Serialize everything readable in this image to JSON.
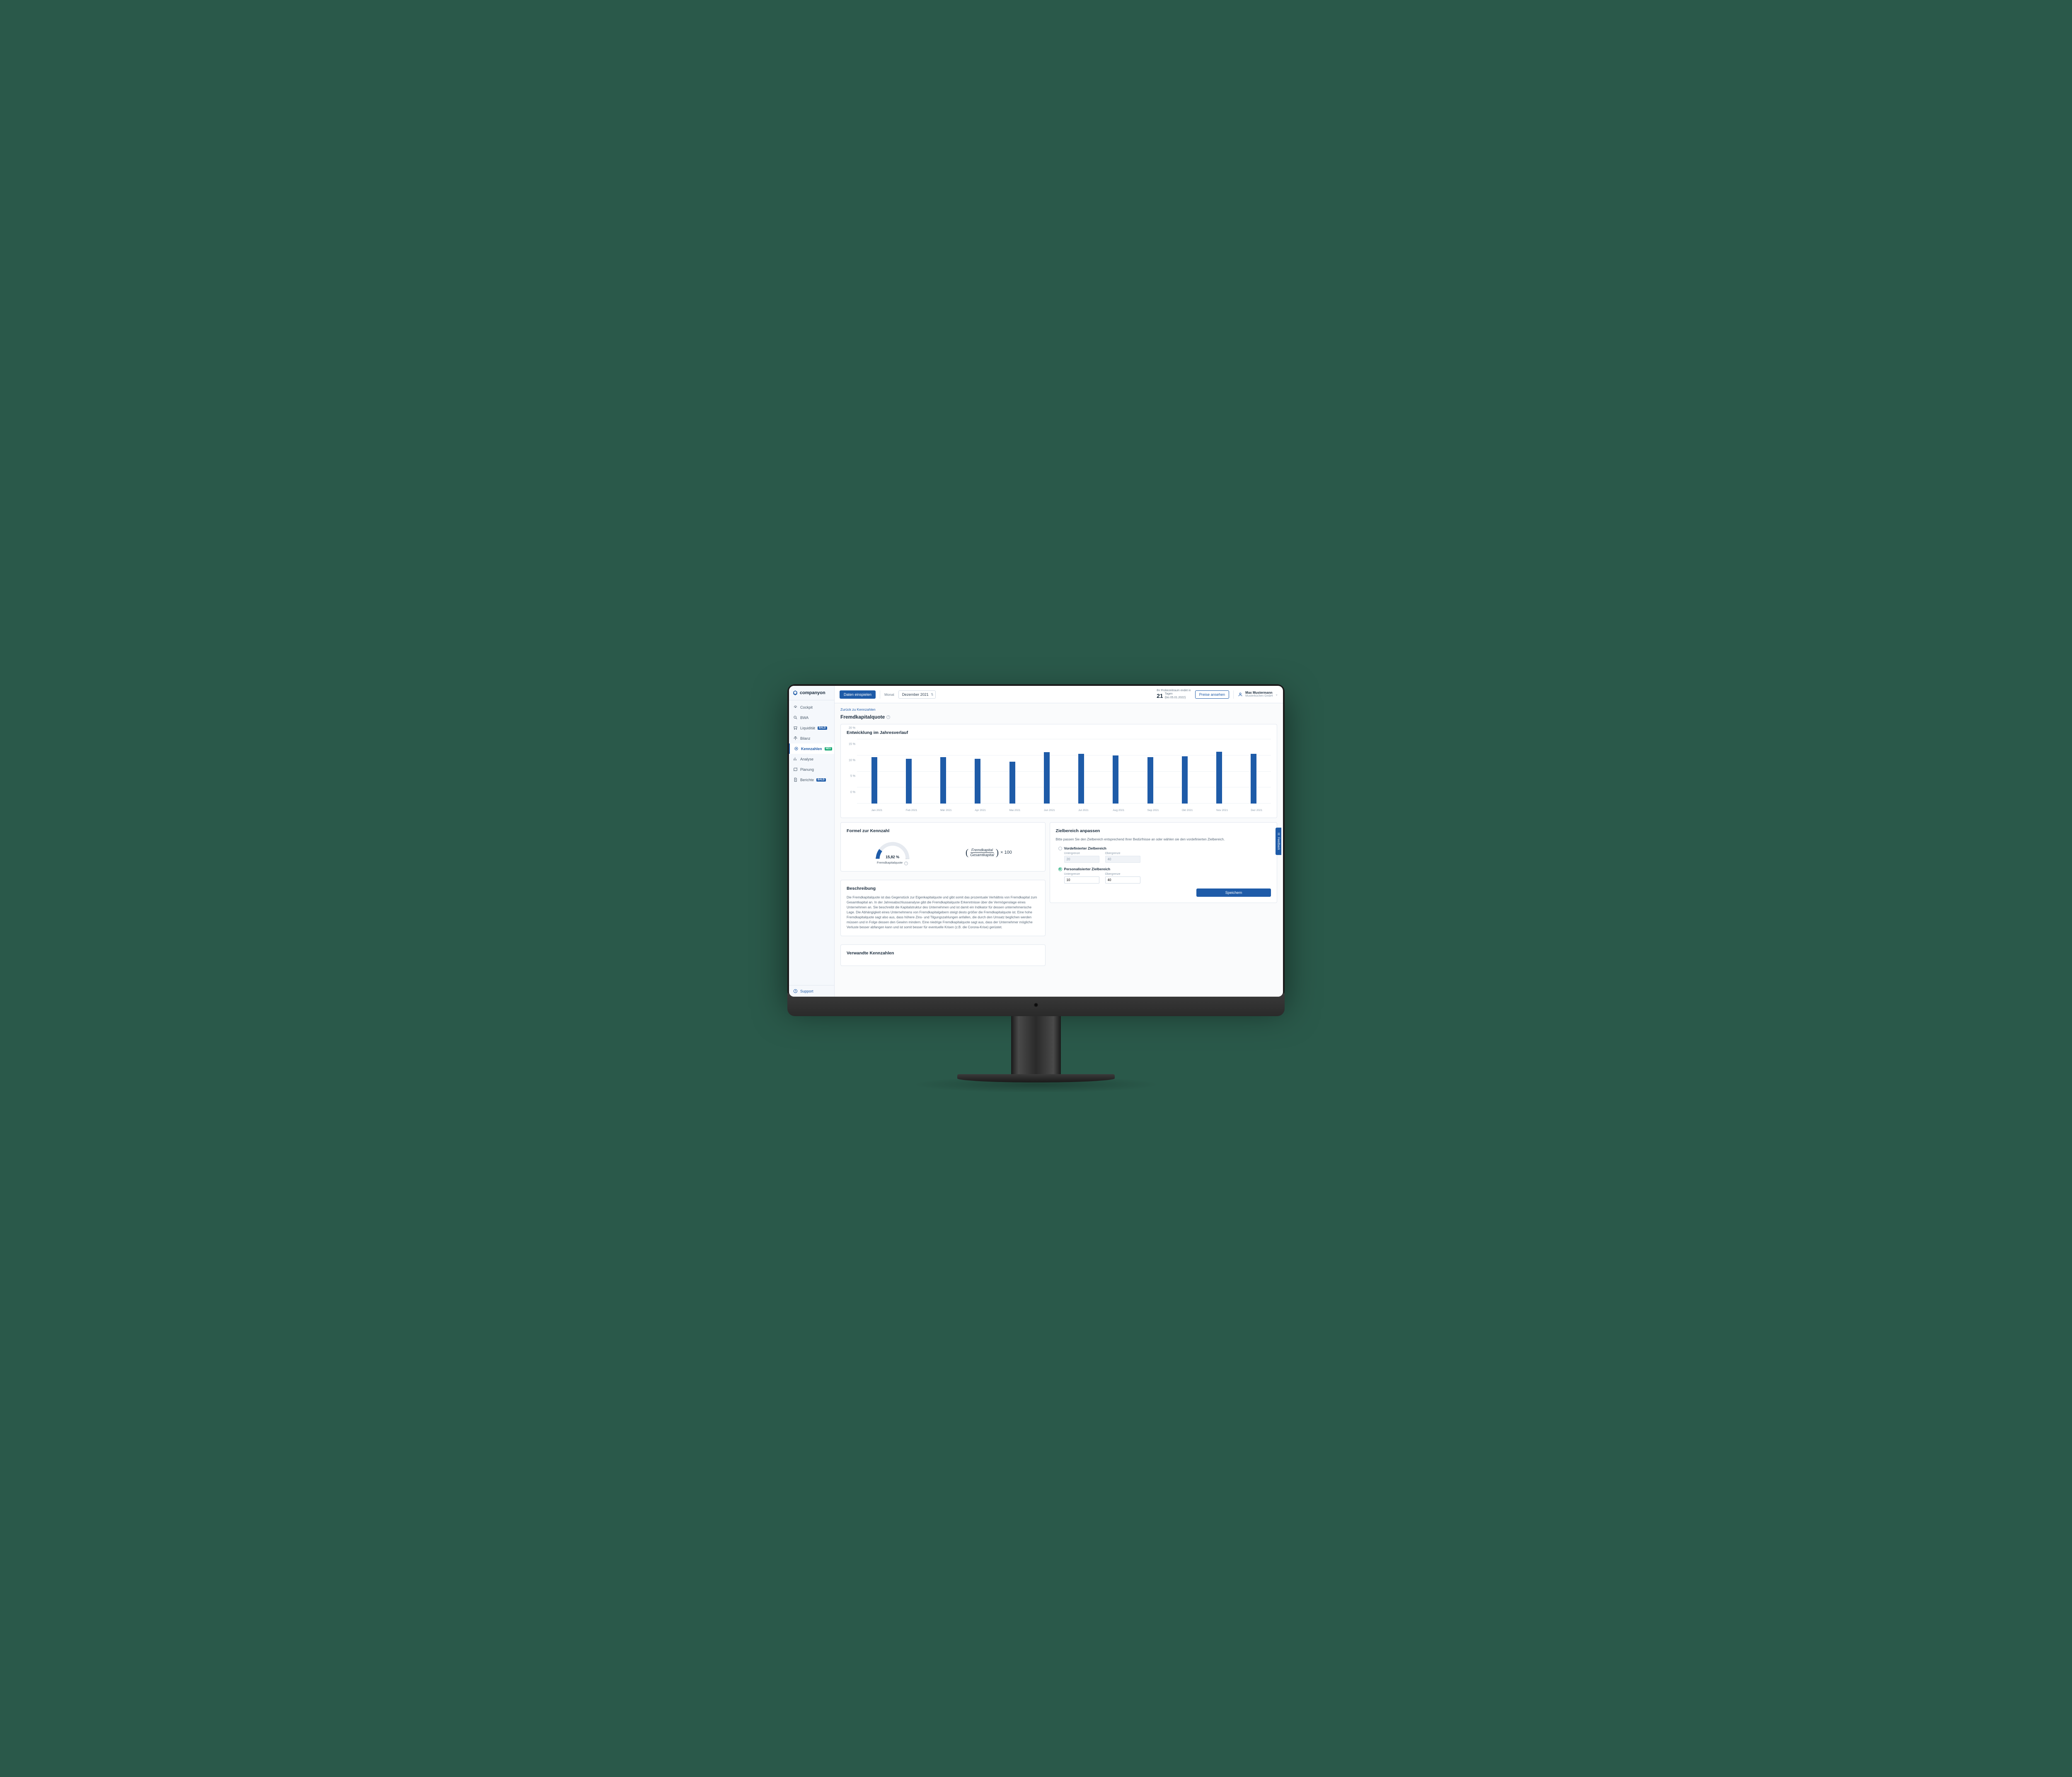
{
  "logo_text": "companyon",
  "topbar": {
    "import_button": "Daten einspielen",
    "month_label": "Monat",
    "month_value": "Dezember 2021",
    "trial_label": "Ihr Probezeitraum endet in",
    "trial_days": "21",
    "trial_days_unit": "Tagen",
    "trial_until": "(bis 05.01.2022)",
    "prices_button": "Preise ansehen",
    "user_name": "Max Mustermann",
    "user_company": "Musterküchen GmbH"
  },
  "sidebar": {
    "items": [
      {
        "label": "Cockpit"
      },
      {
        "label": "BWA"
      },
      {
        "label": "Liquidität",
        "badge": "BALD"
      },
      {
        "label": "Bilanz"
      },
      {
        "label": "Kennzahlen",
        "badge": "NEU",
        "active": true
      },
      {
        "label": "Analyse"
      },
      {
        "label": "Planung"
      },
      {
        "label": "Berichte",
        "badge": "BALD"
      }
    ],
    "support": "Support"
  },
  "page": {
    "backlink": "Zurück zu Kennzahlen",
    "title": "Fremdkapitalquote"
  },
  "chart_card_title": "Entwicklung im Jahresverlauf",
  "chart_data": {
    "type": "bar",
    "categories": [
      "Jan 2021",
      "Feb 2021",
      "Mär 2021",
      "Apr 2021",
      "Mai 2021",
      "Jun 2021",
      "Jul 2021",
      "Aug 2021",
      "Sep 2021",
      "Okt 2021",
      "Nov 2021",
      "Dez 2021"
    ],
    "values": [
      14.5,
      14,
      14.5,
      14,
      13,
      16,
      15.5,
      15,
      14.5,
      14.8,
      16.2,
      15.5
    ],
    "ylim": [
      0,
      20
    ],
    "y_ticks": [
      "0 %",
      "5 %",
      "10 %",
      "15 %",
      "20 %"
    ]
  },
  "formula": {
    "title": "Formel zur Kennzahl",
    "gauge_value": "15,82 %",
    "gauge_min": "0",
    "gauge_max": "100",
    "gauge_label": "Fremdkapitalquote",
    "numerator": "Fremdkapital",
    "denominator": "Gesamtkapital",
    "times": "× 100"
  },
  "description": {
    "title": "Beschreibung",
    "text": "Die Fremdkapitalquote ist das Gegenstück zur Eigenkapitalquote und gibt somit das prozentuale Verhältnis von Fremdkapital zum Gesamtkapital an. In der Jahresabschlussanalyse gibt die Fremdkapitalquote Erkenntnisse über die Vermögenslage eines Unternehmen an. Sie beschreibt die Kapitalstruktur des Unternehmen und ist damit ein Indikator für dessen unternehmerische Lage. Die Abhängigkeit eines Unternehmens von Fremdkapitalgebern steigt desto größer die Fremdkapitalquote ist. Eine hohe Fremdkapitalquote sagt also aus, dass höhere Zins- und Tilgungszahlungen anfallen, die durch den Umsatz beglichen werden müssen und in Folge dessen den Gewinn mindern. Eine niedrige Fremdkapitalquote sagt aus, dass der Unternehmer mögliche Verluste besser abfangen kann und ist somit besser für eventuelle Krisen (z.B. die Corona-Krise) gerüstet."
  },
  "target": {
    "title": "Zielbereich anpassen",
    "subtitle": "Bitte passen Sie den Zielbereich entsprechend Ihrer Bedürfnisse an oder wählen sie den vordefinierten Zielbereich.",
    "predef_title": "Vordefinierter Zielbereich",
    "custom_title": "Personalisierter Zielbereich",
    "lower_label": "Untergrenze",
    "upper_label": "Obergrenze",
    "predef_lower": "20",
    "predef_upper": "40",
    "custom_lower": "10",
    "custom_upper": "40",
    "save": "Speichern"
  },
  "related_title": "Verwandte Kennzahlen",
  "feedback": "Feedback"
}
